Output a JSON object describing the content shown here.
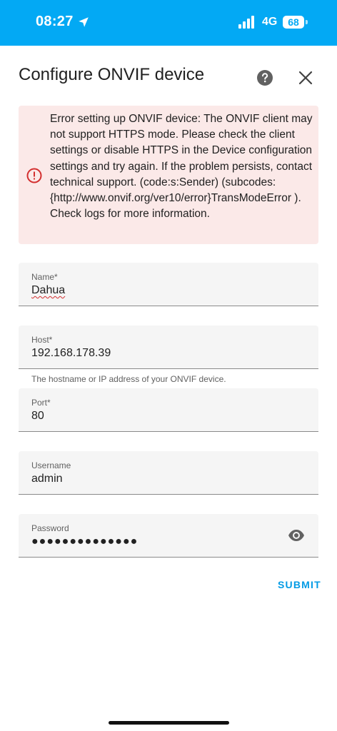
{
  "status_bar": {
    "time": "08:27",
    "network": "4G",
    "battery": "68",
    "location_icon": "location-arrow-icon",
    "signal_icon": "signal-bars-icon"
  },
  "dialog": {
    "title": "Configure ONVIF device",
    "help_icon": "help-circle-icon",
    "close_icon": "close-icon"
  },
  "error": {
    "icon": "alert-circle-icon",
    "message": "Error setting up ONVIF device: The ONVIF client may not support HTTPS mode. Please check the client settings or disable HTTPS in the Device configuration settings and try again. If the problem persists, contact technical support. (code:s:Sender) (subcodes: {http://www.onvif.org/ver10/error}TransModeError ). Check logs for more information.",
    "color": "#d32f2f",
    "background": "#fbe9e8"
  },
  "form": {
    "name": {
      "label": "Name*",
      "value": "Dahua"
    },
    "host": {
      "label": "Host*",
      "value": "192.168.178.39",
      "helper": "The hostname or IP address of your ONVIF device."
    },
    "port": {
      "label": "Port*",
      "value": "80"
    },
    "username": {
      "label": "Username",
      "value": "admin"
    },
    "password": {
      "label": "Password",
      "value": "●●●●●●●●●●●●●●",
      "toggle_icon": "eye-icon"
    }
  },
  "actions": {
    "submit_label": "SUBMIT"
  },
  "colors": {
    "header": "#03a9f4",
    "accent": "#039be5"
  }
}
